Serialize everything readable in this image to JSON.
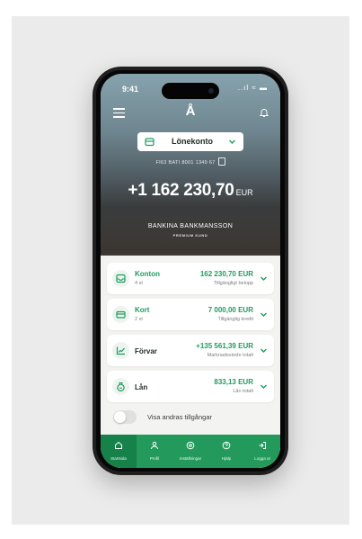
{
  "status": {
    "time": "9:41",
    "icons": "..ıl ≈ ▬"
  },
  "header": {
    "logo": "Å"
  },
  "account": {
    "name": "Lönekonto",
    "iban": "FI63 BATI 8001 1349 67"
  },
  "balance": {
    "amount": "+1 162 230,70",
    "currency": "EUR"
  },
  "holder": {
    "name": "BANKINA BANKMANSSON",
    "tier": "PREMIUM KUND"
  },
  "assets": [
    {
      "icon": "inbox-icon",
      "label": "Konton",
      "sub": "4 st",
      "value": "162 230,70 EUR",
      "note": "Tillgängligt belopp"
    },
    {
      "icon": "card-icon",
      "label": "Kort",
      "sub": "2 st",
      "value": "7 000,00 EUR",
      "note": "Tillgänglig kredit"
    },
    {
      "icon": "chart-icon",
      "label": "Förvar",
      "sub": "",
      "value": "+135 561,39 EUR",
      "note": "Marknadsvärde totalt"
    },
    {
      "icon": "loan-icon",
      "label": "Lån",
      "sub": "",
      "value": "833,13 EUR",
      "note": "Lån totalt"
    }
  ],
  "toggle": {
    "label": "Visa andras tillgångar",
    "on": false
  },
  "tabs": [
    {
      "icon": "home-icon",
      "label": "Startsida",
      "active": true
    },
    {
      "icon": "profile-icon",
      "label": "Profil",
      "active": false
    },
    {
      "icon": "transfer-icon",
      "label": "Inställningar",
      "active": false
    },
    {
      "icon": "help-icon",
      "label": "Hjälp",
      "active": false
    },
    {
      "icon": "logout-icon",
      "label": "Logga ut",
      "active": false
    }
  ],
  "colors": {
    "accent": "#1e9d5f",
    "tabbar": "#239a5c",
    "tab_active": "#17814a"
  }
}
